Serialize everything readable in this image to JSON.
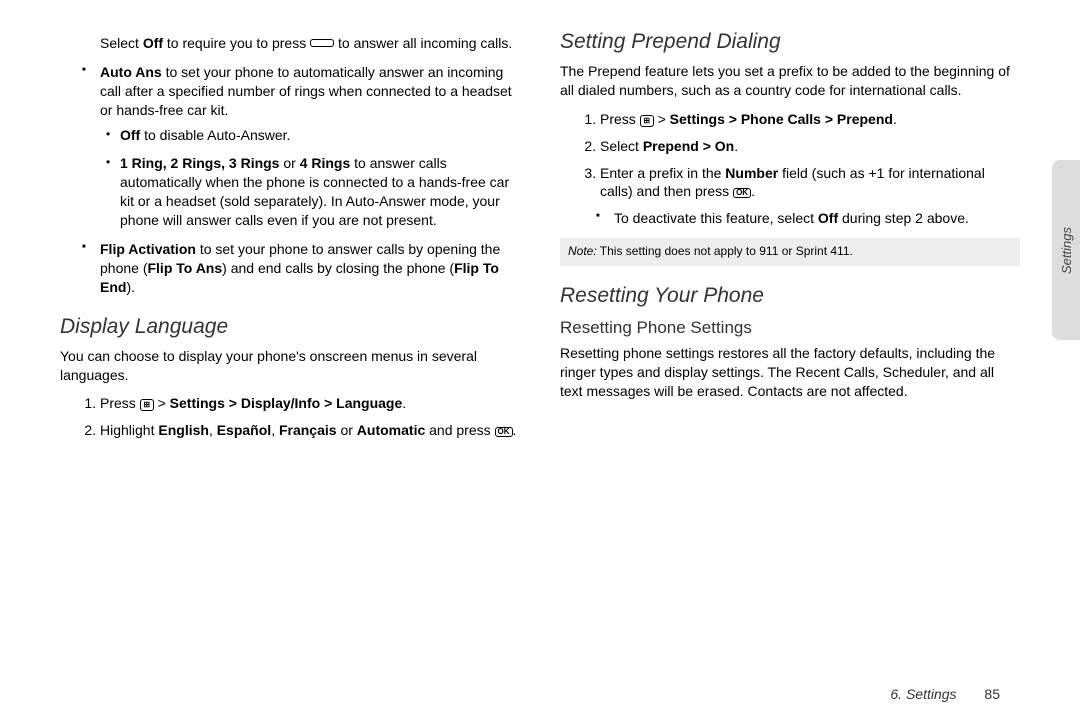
{
  "left": {
    "auto_ans_intro_select": "Select ",
    "off1": "Off",
    "auto_ans_intro_rest": " to require you to press ",
    "auto_ans_intro_end": " to answer all incoming calls.",
    "auto_ans_label": "Auto Ans",
    "auto_ans_text": " to set your phone to automatically answer an incoming call after a specified number of rings when connected to a headset or hands-free car kit.",
    "sub_off_label": "Off",
    "sub_off_text": " to disable Auto-Answer.",
    "sub_rings_label": "1 Ring, 2 Rings, 3 Rings",
    "sub_rings_or": " or ",
    "sub_rings_label2": "4 Rings",
    "sub_rings_text": " to answer calls automatically when the phone is connected to a hands-free car kit or a headset (sold separately). In Auto-Answer mode, your phone will answer calls even if you are not present.",
    "flip_label": "Flip Activation",
    "flip_text_a": " to set your phone to answer calls by opening the phone (",
    "flip_ans": "Flip To Ans",
    "flip_text_b": ") and end calls by closing the phone (",
    "flip_end": "Flip To End",
    "flip_text_c": ").",
    "dl_heading": "Display Language",
    "dl_intro": "You can choose to display your phone's onscreen menus in several languages.",
    "dl_step1_a": "Press ",
    "dl_step1_b": " > ",
    "dl_step1_path": "Settings > Display/Info > Language",
    "dl_step1_dot": ".",
    "dl_step2_a": "Highlight ",
    "dl_en": "English",
    "dl_comma1": ", ",
    "dl_es": "Español",
    "dl_comma2": ",  ",
    "dl_fr": "Français",
    "dl_or": " or ",
    "dl_auto": "Automatic",
    "dl_step2_b": " and press ",
    "dl_step2_dot": "."
  },
  "right": {
    "spd_heading": "Setting Prepend Dialing",
    "spd_intro": "The Prepend feature lets you set a prefix to be added to the beginning of all dialed numbers, such as a country code for international calls.",
    "spd_step1_a": "Press ",
    "spd_step1_gt": " > ",
    "spd_step1_path": "Settings > Phone Calls > Prepend",
    "spd_step1_dot": ".",
    "spd_step2_a": "Select ",
    "spd_step2_path": "Prepend > On",
    "spd_step2_dot": ".",
    "spd_step3_a": "Enter a prefix in the ",
    "spd_number": "Number",
    "spd_step3_b": " field (such as +1 for international calls) and then press ",
    "spd_step3_dot": ".",
    "spd_deact_a": "To deactivate this feature, select ",
    "spd_off": "Off",
    "spd_deact_b": " during step 2 above.",
    "note_label": "Note:",
    "note_text": "  This setting does not apply to 911 or Sprint 411.",
    "reset_heading": "Resetting Your Phone",
    "reset_sub": "Resetting Phone Settings",
    "reset_body": "Resetting phone settings restores all the factory defaults, including the ringer types and display settings. The Recent Calls, Scheduler, and all text messages will be erased. Contacts are not affected."
  },
  "tab": "Settings",
  "footer_chapter": "6. Settings",
  "footer_page": "85"
}
